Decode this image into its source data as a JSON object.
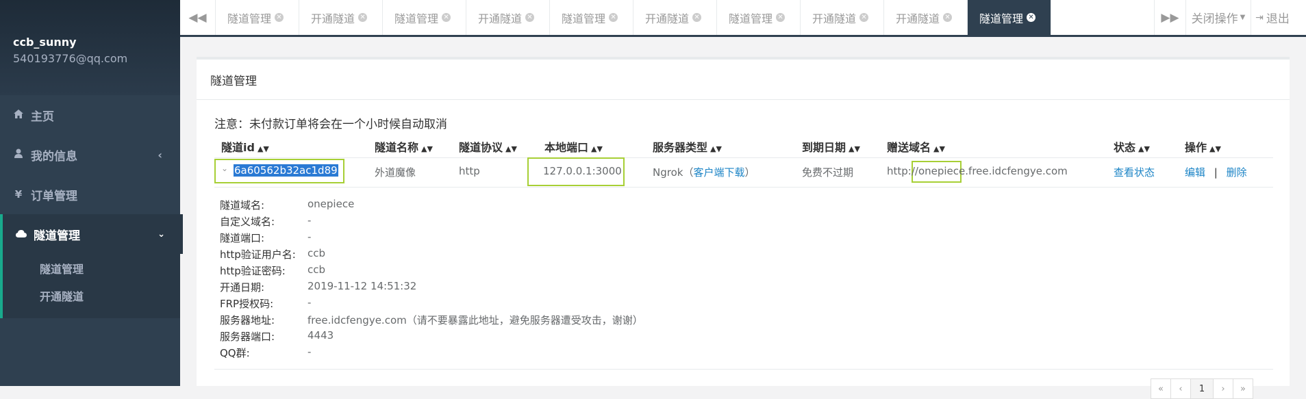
{
  "user": {
    "name": "ccb_sunny",
    "email": "540193776@qq.com"
  },
  "nav": [
    {
      "label": "主页",
      "icon": "home-icon"
    },
    {
      "label": "我的信息",
      "icon": "user-icon"
    },
    {
      "label": "订单管理",
      "icon": "yen-icon"
    },
    {
      "label": "隧道管理",
      "icon": "cloud-icon"
    }
  ],
  "subnav": [
    "隧道管理",
    "开通隧道"
  ],
  "tabs": [
    {
      "label": "隧道管理"
    },
    {
      "label": "开通隧道"
    },
    {
      "label": "隧道管理"
    },
    {
      "label": "开通隧道"
    },
    {
      "label": "隧道管理"
    },
    {
      "label": "开通隧道"
    },
    {
      "label": "隧道管理"
    },
    {
      "label": "开通隧道"
    },
    {
      "label": "开通隧道"
    },
    {
      "label": "隧道管理"
    }
  ],
  "active_tab_index": 9,
  "top_right": {
    "close_ops": "关闭操作",
    "logout": "退出"
  },
  "panel": {
    "title": "隧道管理",
    "notice": "注意：未付款订单将会在一个小时候自动取消",
    "columns": [
      "隧道id",
      "隧道名称",
      "隧道协议",
      "本地端口",
      "服务器类型",
      "到期日期",
      "赠送域名",
      "状态",
      "操作"
    ],
    "row": {
      "id": "6a60562b32ac1d89",
      "name": "外道魔像",
      "protocol": "http",
      "local_port": "127.0.0.1:3000",
      "server_type": "Ngrok",
      "download_open": "（",
      "download_link": "客户端下载",
      "download_close": "）",
      "expiry": "免费不过期",
      "domain_prefix": "http://",
      "domain_sub": "onepiece",
      "domain_suffix": ".free.idcfengye.com",
      "status_link": "查看状态",
      "edit": "编辑",
      "sep": "|",
      "delete": "删除"
    },
    "details": [
      {
        "label": "隧道域名:",
        "value": "onepiece"
      },
      {
        "label": "自定义域名:",
        "value": "-"
      },
      {
        "label": "隧道端口:",
        "value": "-"
      },
      {
        "label": "http验证用户名:",
        "value": "ccb"
      },
      {
        "label": "http验证密码:",
        "value": "ccb"
      },
      {
        "label": "开通日期:",
        "value": "2019-11-12 14:51:32"
      },
      {
        "label": "FRP授权码:",
        "value": "-"
      },
      {
        "label": "服务器地址:",
        "value": "free.idcfengye.com（请不要暴露此地址，避免服务器遭受攻击，谢谢）"
      },
      {
        "label": "服务器端口:",
        "value": "4443"
      },
      {
        "label": "QQ群:",
        "value": "-"
      }
    ],
    "pagination": [
      "«",
      "‹",
      "1",
      "›",
      "»"
    ]
  },
  "colors": {
    "sidebar": "#2f4050",
    "accent": "#19aa8d",
    "highlight": "#a7cf35",
    "link": "#1c84c6"
  }
}
